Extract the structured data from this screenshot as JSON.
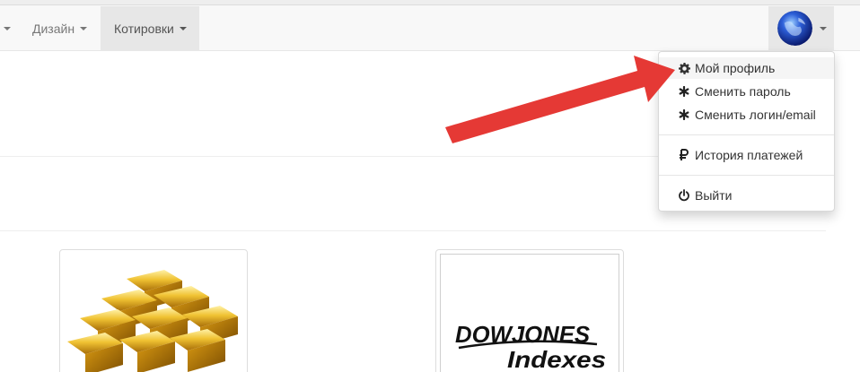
{
  "navbar": {
    "items": [
      {
        "label": "Дизайн"
      },
      {
        "label": "Котировки"
      }
    ],
    "user_menu": {
      "avatar_icon": "globe-avatar-icon"
    }
  },
  "dropdown": {
    "items": [
      {
        "label": "Мой профиль",
        "icon": "gear-icon"
      },
      {
        "label": "Сменить пароль",
        "icon": "asterisk-icon"
      },
      {
        "label": "Сменить логин/email",
        "icon": "asterisk-icon"
      },
      {
        "label": "История платежей",
        "icon": "ruble-icon"
      },
      {
        "label": "Выйти",
        "icon": "power-icon"
      }
    ]
  },
  "thumbnails": [
    {
      "name": "gold-bars-image"
    },
    {
      "name": "dow-jones-indexes-logo",
      "logo_line1": "DOWJONES",
      "logo_line2": "Indexes"
    }
  ],
  "annotation": {
    "arrow_color": "#e53935"
  }
}
